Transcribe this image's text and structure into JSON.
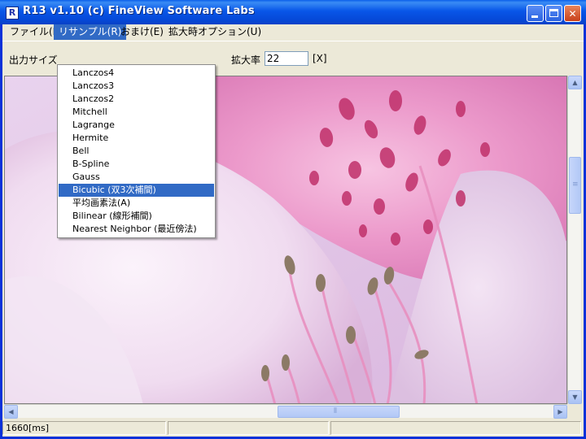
{
  "window": {
    "title": "R13 v1.10 (c) FineView Software Labs",
    "app_icon": "R"
  },
  "menubar": {
    "items": [
      {
        "label": "ファイル(F)"
      },
      {
        "label": "リサンプル(R)"
      },
      {
        "label": "おまけ(E)"
      },
      {
        "label": "拡大時オプション(U)"
      }
    ]
  },
  "toolbar": {
    "output_size_label": "出力サイズ",
    "zoom_label": "拡大率",
    "zoom_value": "22",
    "zoom_unit": "[X]"
  },
  "resample_menu": {
    "items": [
      {
        "label": "Lanczos4"
      },
      {
        "label": "Lanczos3"
      },
      {
        "label": "Lanczos2"
      },
      {
        "label": "Mitchell"
      },
      {
        "label": "Lagrange"
      },
      {
        "label": "Hermite"
      },
      {
        "label": "Bell"
      },
      {
        "label": "B-Spline"
      },
      {
        "label": "Gauss"
      },
      {
        "label": "Bicubic (双3次補間)",
        "selected": true
      },
      {
        "label": "平均画素法(A)"
      },
      {
        "label": "Bilinear (線形補間)"
      },
      {
        "label": "Nearest Neighbor (最近傍法)"
      }
    ]
  },
  "statusbar": {
    "time": "1660[ms]",
    "pane2": "",
    "pane3": ""
  },
  "colors": {
    "accent": "#316ac5",
    "titlebar": "#0a5fea",
    "petal_spot": "#c0306a"
  },
  "icons": {
    "minimize": "minimize-icon",
    "maximize": "maximize-icon",
    "close": "close-icon"
  }
}
